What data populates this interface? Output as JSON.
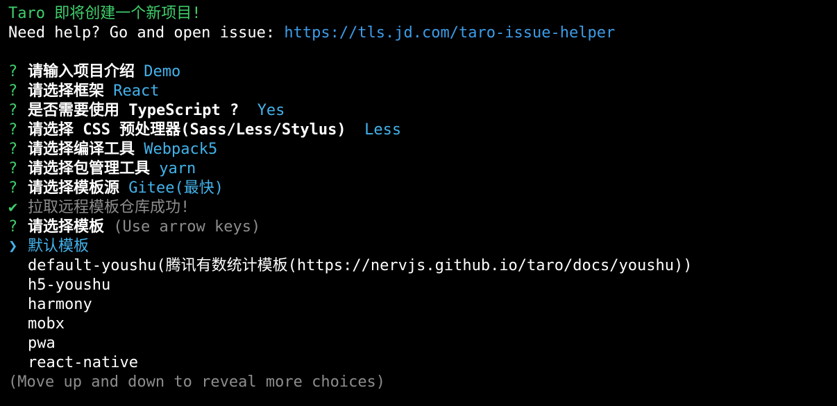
{
  "colors": {
    "background": "#000000",
    "text": "#ffffff",
    "green": "#3fcf6b",
    "link": "#3d9ce8",
    "answer": "#43b2ea",
    "muted": "#8d8d8d"
  },
  "header": {
    "title": "Taro 即将创建一个新项目!",
    "help_prefix": "Need help? Go and open issue: ",
    "help_link": "https://tls.jd.com/taro-issue-helper"
  },
  "prompts": [
    {
      "question": "请输入项目介绍",
      "answer": "Demo"
    },
    {
      "question": "请选择框架",
      "answer": "React"
    },
    {
      "question": "是否需要使用 TypeScript ?",
      "answer": "Yes"
    },
    {
      "question": "请选择 CSS 预处理器(Sass/Less/Stylus)",
      "answer": "Less"
    },
    {
      "question": "请选择编译工具",
      "answer": "Webpack5"
    },
    {
      "question": "请选择包管理工具",
      "answer": "yarn"
    },
    {
      "question": "请选择模板源",
      "answer": "Gitee(最快)"
    }
  ],
  "question_mark": "?",
  "success": {
    "icon": "✔",
    "text": "拉取远程模板仓库成功!"
  },
  "template_prompt": {
    "question": "请选择模板",
    "hint": "(Use arrow keys)"
  },
  "choices": {
    "pointer": "❯",
    "selected": "默认模板",
    "items": [
      "default-youshu(腾讯有数统计模板(https://nervjs.github.io/taro/docs/youshu))",
      "h5-youshu",
      "harmony",
      "mobx",
      "pwa",
      "react-native"
    ]
  },
  "footer_hint": "(Move up and down to reveal more choices)"
}
